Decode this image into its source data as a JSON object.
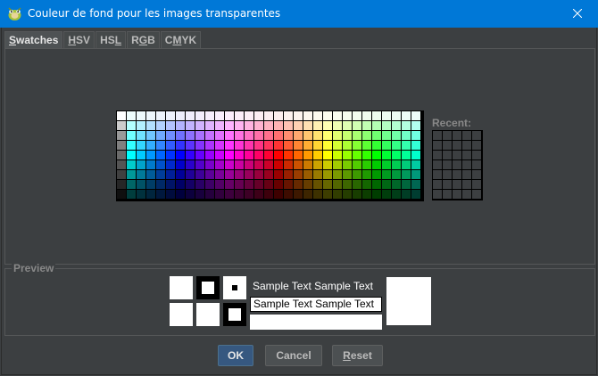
{
  "window": {
    "title": "Couleur de fond pour les images transparentes",
    "icon": "gimp-icon",
    "close_icon": "close-icon"
  },
  "tabs": [
    {
      "mnemonic": "S",
      "rest": "watches",
      "active": true
    },
    {
      "mnemonic": "H",
      "rest": "SV",
      "active": false
    },
    {
      "pre": "HS",
      "mnemonic": "L",
      "rest": "",
      "active": false
    },
    {
      "pre": "R",
      "mnemonic": "G",
      "rest": "B",
      "active": false
    },
    {
      "pre": "C",
      "mnemonic": "M",
      "rest": "YK",
      "active": false
    }
  ],
  "swatches": {
    "columns": 31,
    "rows": 9,
    "recent_label": "Recent:",
    "recent_columns": 5,
    "recent_rows": 7,
    "recent_color": "#3c3f41"
  },
  "preview": {
    "legend": "Preview",
    "sample_text": "Sample Text  Sample Text",
    "color": "#ffffff"
  },
  "buttons": {
    "ok": {
      "label": "OK"
    },
    "cancel": {
      "label": "Cancel"
    },
    "reset": {
      "mnemonic": "R",
      "rest": "eset"
    }
  },
  "colors": {
    "titlebar": "#0078d7",
    "background": "#3c3f41",
    "default_button": "#365880"
  }
}
